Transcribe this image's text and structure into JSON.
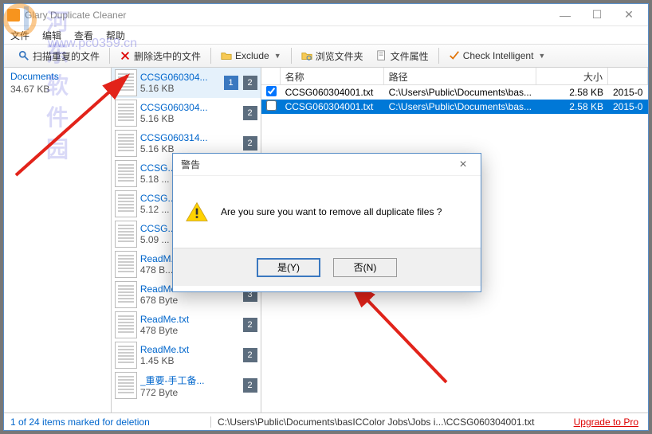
{
  "window": {
    "title": "Glary Duplicate Cleaner"
  },
  "menu": {
    "file": "文件",
    "edit": "编辑",
    "view": "查看",
    "help": "帮助"
  },
  "toolbar": {
    "scan": "扫描重复的文件",
    "delete": "删除选中的文件",
    "exclude": "Exclude",
    "browse": "浏览文件夹",
    "props": "文件属性",
    "check": "Check Intelligent"
  },
  "folders": {
    "name": "Documents",
    "size": "34.67 KB"
  },
  "groups": [
    {
      "name": "CCSG060304...",
      "size": "5.16 KB",
      "count": "2",
      "count2": "1",
      "selected": true
    },
    {
      "name": "CCSG060304...",
      "size": "5.16 KB",
      "count": "2"
    },
    {
      "name": "CCSG060314...",
      "size": "5.16 KB",
      "count": "2"
    },
    {
      "name": "CCSG...",
      "size": "5.18 ...",
      "count": ""
    },
    {
      "name": "CCSG...",
      "size": "5.12 ...",
      "count": ""
    },
    {
      "name": "CCSG...",
      "size": "5.09 ...",
      "count": ""
    },
    {
      "name": "ReadM...",
      "size": "478 B...",
      "count": ""
    },
    {
      "name": "ReadMe.txt",
      "size": "678 Byte",
      "count": "3"
    },
    {
      "name": "ReadMe.txt",
      "size": "478 Byte",
      "count": "2"
    },
    {
      "name": "ReadMe.txt",
      "size": "1.45 KB",
      "count": "2"
    },
    {
      "name": "_重要-手工备...",
      "size": "772 Byte",
      "count": "2"
    }
  ],
  "table": {
    "headers": {
      "name": "名称",
      "path": "路径",
      "size": "大小",
      "date": ""
    },
    "rows": [
      {
        "checked": true,
        "name": "CCSG060304001.txt",
        "path": "C:\\Users\\Public\\Documents\\bas...",
        "size": "2.58 KB",
        "date": "2015-0"
      },
      {
        "checked": false,
        "name": "CCSG060304001.txt",
        "path": "C:\\Users\\Public\\Documents\\bas...",
        "size": "2.58 KB",
        "date": "2015-0",
        "selected": true
      }
    ]
  },
  "dialog": {
    "title": "警告",
    "message": "Are you sure you want to remove all duplicate files ?",
    "yes": "是(Y)",
    "no": "否(N)"
  },
  "status": {
    "left": "1 of 24 items marked for deletion",
    "path": "C:\\Users\\Public\\Documents\\basICColor Jobs\\Jobs i...\\CCSG060304001.txt",
    "upgrade": "Upgrade to Pro"
  },
  "watermark": {
    "cn": "河东软件园",
    "url": "www.pc0359.cn"
  }
}
